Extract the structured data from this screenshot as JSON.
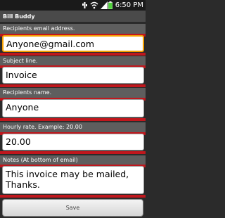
{
  "status_bar": {
    "time": "6:50 PM",
    "icons": [
      "usb-icon",
      "wifi-icon",
      "signal-icon",
      "battery-icon"
    ]
  },
  "app": {
    "title": "Bill Buddy"
  },
  "fields": [
    {
      "label": "Recipients email address.",
      "value": "Anyone@gmail.com",
      "focused": true
    },
    {
      "label": "Subject line.",
      "value": "Invoice",
      "focused": false
    },
    {
      "label": "Recipients name.",
      "value": "Anyone",
      "focused": false
    },
    {
      "label": "Hourly rate. Example: 20.00",
      "value": "20.00",
      "focused": false
    },
    {
      "label": "Notes (At bottom of email)",
      "value": "This invoice may be mailed,\nThanks.",
      "focused": false
    }
  ],
  "save_label": "Save",
  "colors": {
    "accent_red": "#c0171d",
    "focus_orange": "#f5a000",
    "label_bg": "#5e5e5e"
  }
}
